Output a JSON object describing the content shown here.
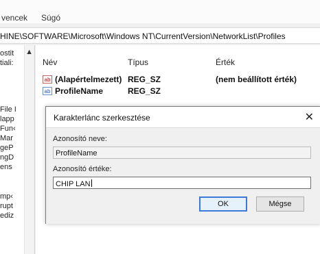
{
  "menubar": {
    "items": [
      "vencek",
      "Súgó"
    ]
  },
  "address": {
    "path": "HINE\\SOFTWARE\\Microsoft\\Windows NT\\CurrentVersion\\NetworkList\\Profiles"
  },
  "tree": {
    "items": [
      "ostit",
      "tiali:",
      "File I",
      "lapp",
      "Fun‹",
      "Mar",
      "geP",
      "ngD",
      "ens",
      "mp‹",
      "rupt",
      "ediz"
    ]
  },
  "columns": {
    "name": "Név",
    "type": "Típus",
    "data": "Érték"
  },
  "rows": [
    {
      "name": "(Alapértelmezett)",
      "type": "REG_SZ",
      "data": "(nem beállított érték)",
      "icon": "ab"
    },
    {
      "name": "ProfileName",
      "type": "REG_SZ",
      "data": "",
      "icon": "ab"
    }
  ],
  "dialog": {
    "title": "Karakterlánc szerkesztése",
    "close": "✕",
    "name_label": "Azonosító neve:",
    "name_value": "ProfileName",
    "value_label": "Azonosító értéke:",
    "value_value": "CHIP LAN",
    "ok": "OK",
    "cancel": "Mégse"
  },
  "colors": {
    "accent": "#3c78d8",
    "string_icon_red": "#c00000",
    "string_icon_blue": "#2456c8"
  }
}
